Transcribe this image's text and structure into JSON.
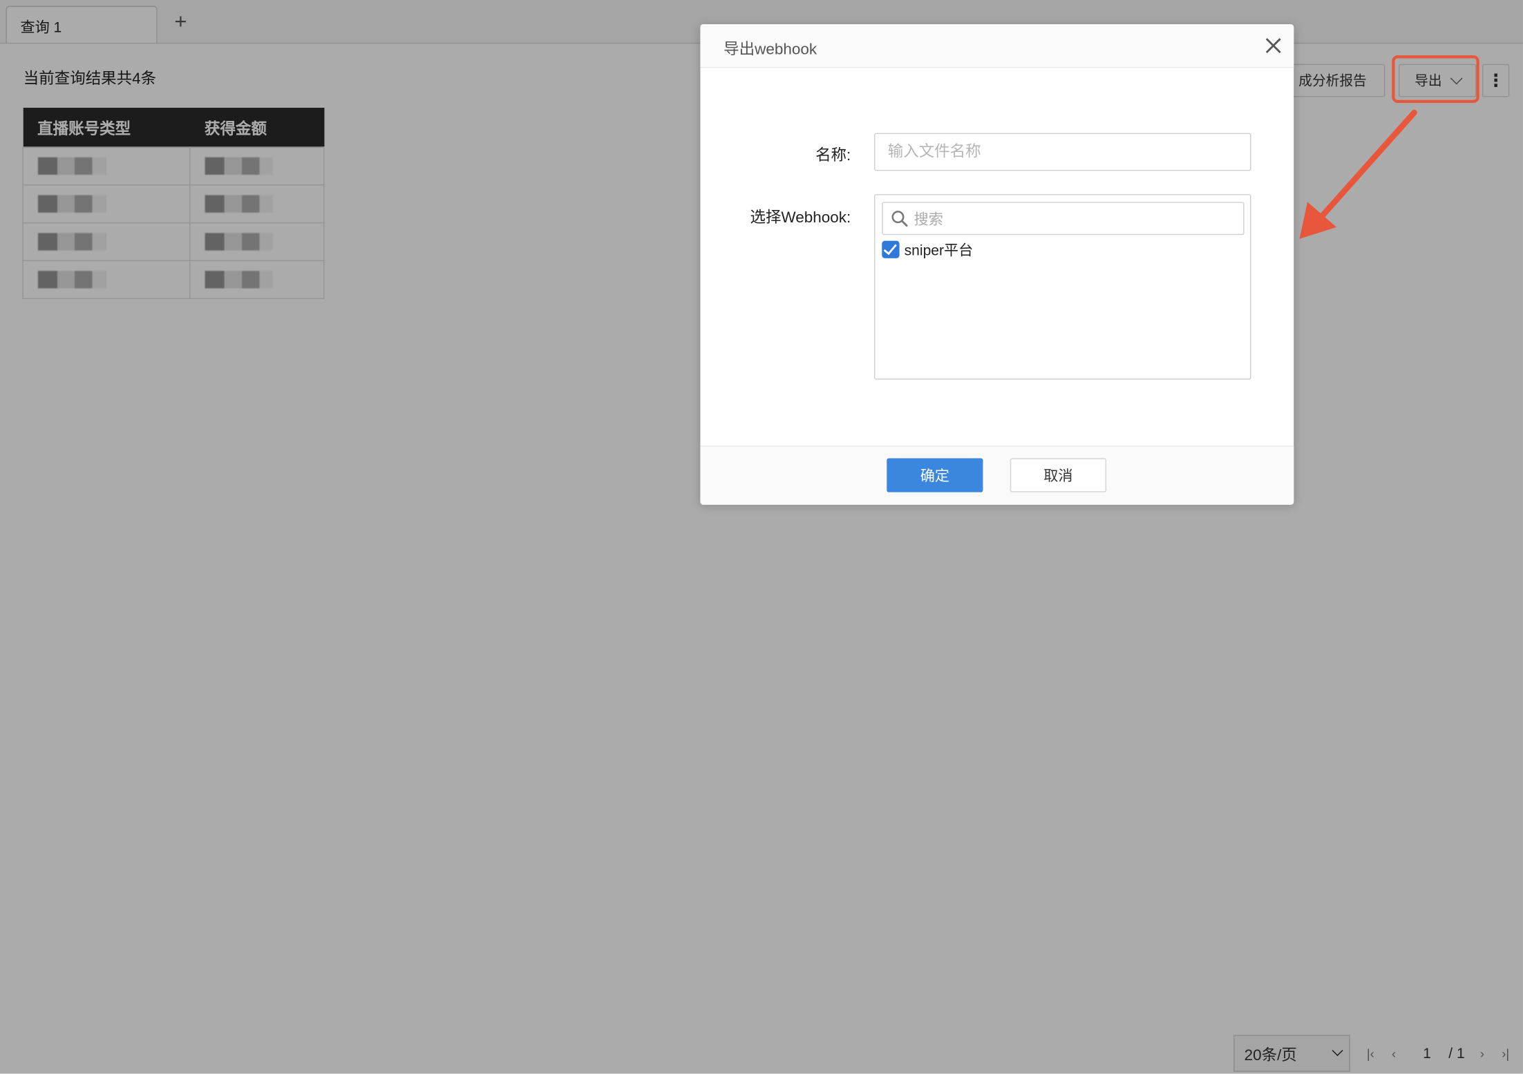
{
  "tabs": [
    {
      "label": "查询 1"
    }
  ],
  "tab_add_symbol": "+",
  "result_summary": "当前查询结果共4条",
  "toolbar": {
    "report_label": "成分析报告",
    "export_label": "导出",
    "more_icon": "more-vertical-icon"
  },
  "table": {
    "headers": [
      "直播账号类型",
      "获得金额"
    ],
    "row_count": 4
  },
  "pagination": {
    "page_size": "20条/页",
    "current_page": "1",
    "total_pages": "/ 1"
  },
  "annotation": {
    "color": "#e8573c"
  },
  "modal": {
    "title": "导出webhook",
    "name_label": "名称:",
    "name_placeholder": "输入文件名称",
    "webhook_label": "选择Webhook:",
    "search_placeholder": "搜索",
    "webhooks": [
      {
        "label": "sniper平台",
        "checked": true
      }
    ],
    "ok_label": "确定",
    "cancel_label": "取消"
  },
  "colors": {
    "primary": "#3b86de",
    "checkbox": "#2f7ad9",
    "overlay": "rgba(0,0,0,0.33)"
  }
}
